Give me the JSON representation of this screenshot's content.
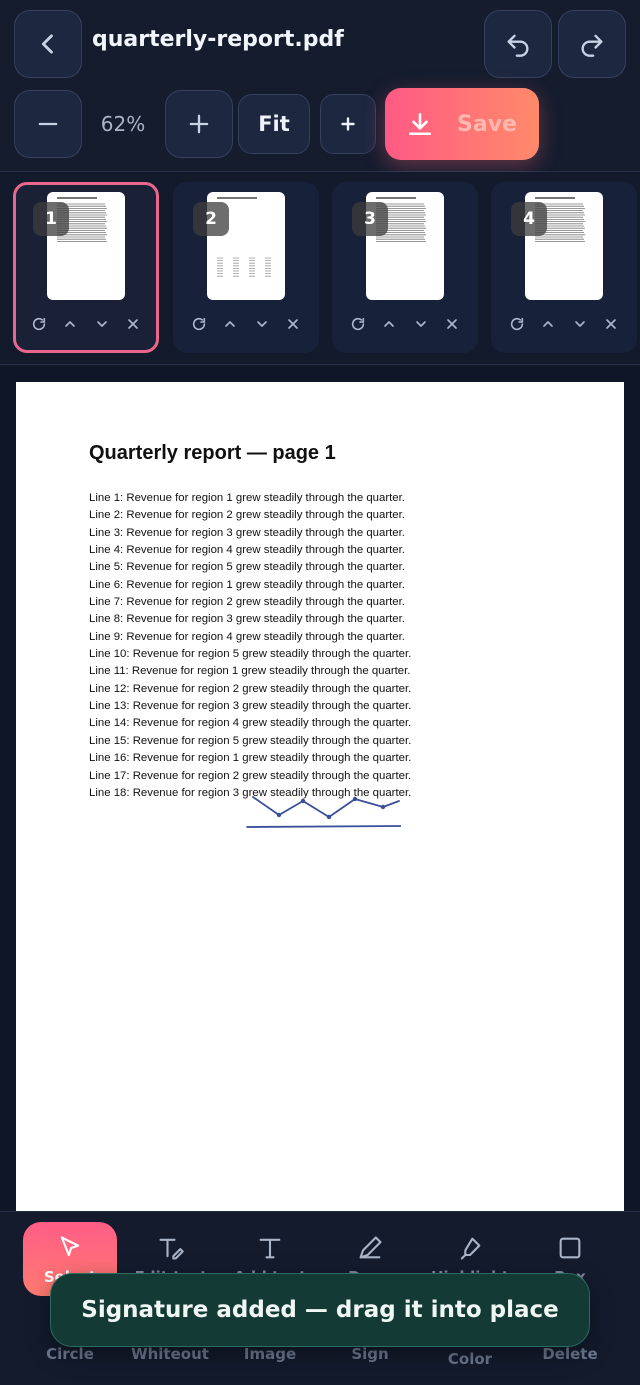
{
  "header": {
    "title": "quarterly-report.pdf",
    "zoom": "62%",
    "fit_label": "Fit",
    "save_label": "Save"
  },
  "thumbnails": [
    {
      "number": "1",
      "active": true
    },
    {
      "number": "2",
      "active": false
    },
    {
      "number": "3",
      "active": false
    },
    {
      "number": "4",
      "active": false
    }
  ],
  "document": {
    "heading": "Quarterly report — page 1",
    "lines": [
      "Line 1: Revenue for region 1 grew steadily through the quarter.",
      "Line 2: Revenue for region 2 grew steadily through the quarter.",
      "Line 3: Revenue for region 3 grew steadily through the quarter.",
      "Line 4: Revenue for region 4 grew steadily through the quarter.",
      "Line 5: Revenue for region 5 grew steadily through the quarter.",
      "Line 6: Revenue for region 1 grew steadily through the quarter.",
      "Line 7: Revenue for region 2 grew steadily through the quarter.",
      "Line 8: Revenue for region 3 grew steadily through the quarter.",
      "Line 9: Revenue for region 4 grew steadily through the quarter.",
      "Line 10: Revenue for region 5 grew steadily through the quarter.",
      "Line 11: Revenue for region 1 grew steadily through the quarter.",
      "Line 12: Revenue for region 2 grew steadily through the quarter.",
      "Line 13: Revenue for region 3 grew steadily through the quarter.",
      "Line 14: Revenue for region 4 grew steadily through the quarter.",
      "Line 15: Revenue for region 5 grew steadily through the quarter.",
      "Line 16: Revenue for region 1 grew steadily through the quarter.",
      "Line 17: Revenue for region 2 grew steadily through the quarter.",
      "Line 18: Revenue for region 3 grew steadily through the quarter."
    ]
  },
  "toolbar": {
    "row1": [
      "Select",
      "Edit text",
      "Add text",
      "Draw",
      "Highlight",
      "Box"
    ],
    "row2": [
      "Circle",
      "Whiteout",
      "Image",
      "Sign",
      "Color",
      "Delete"
    ]
  },
  "toast": "Signature added — drag it into place",
  "colors": {
    "accent": "#ff5a84",
    "active_thumb_border": "#e9678f",
    "signature_ink": "#3a4f9a",
    "toast_bg": "#133a35"
  }
}
